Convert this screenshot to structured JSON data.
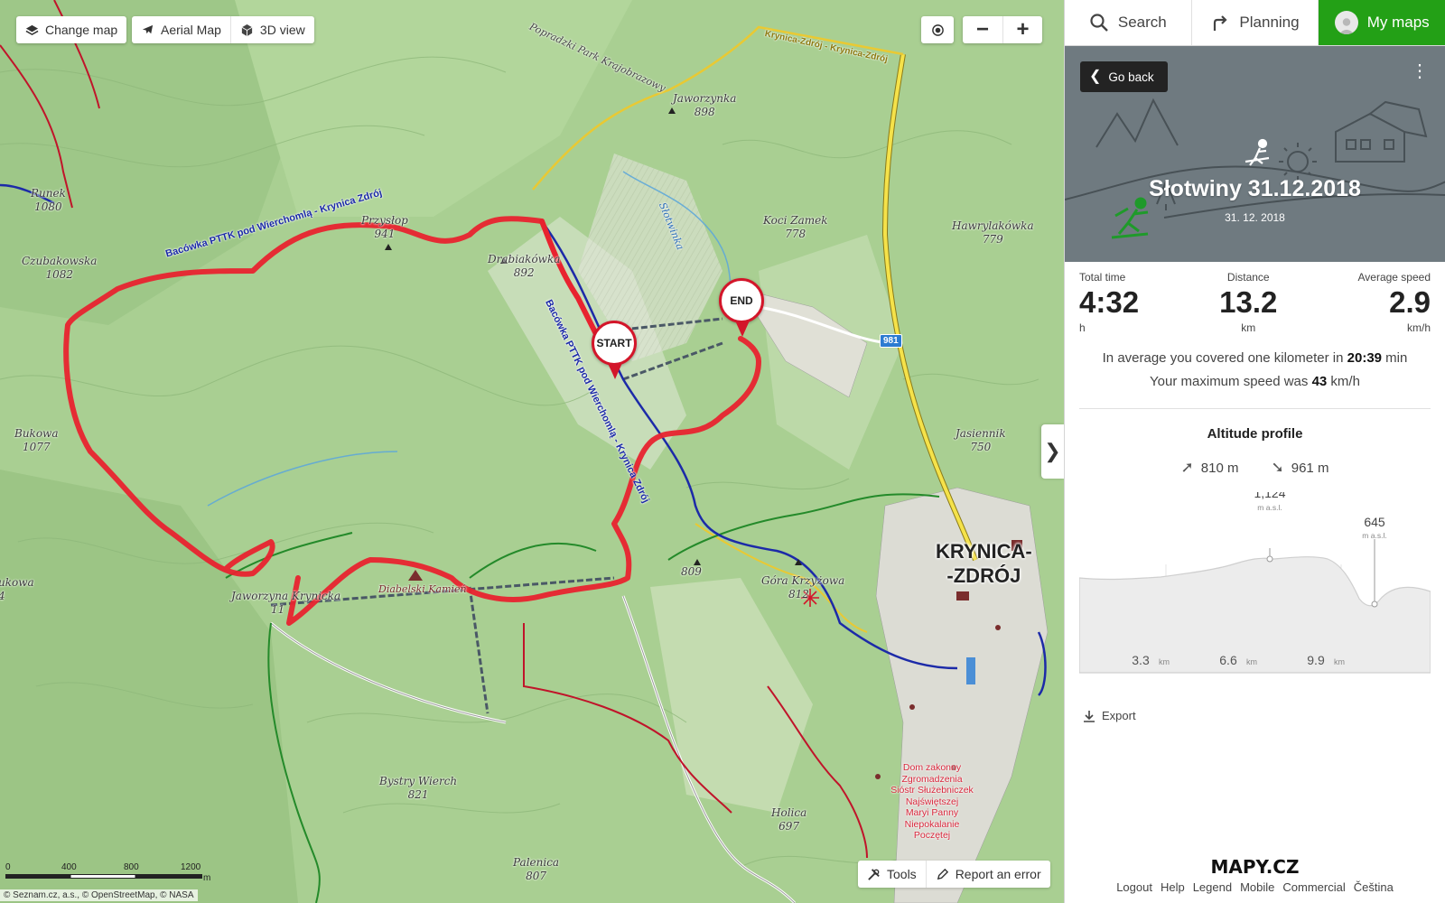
{
  "map_controls": {
    "change_map": "Change map",
    "aerial_map": "Aerial Map",
    "view_3d": "3D view",
    "zoom_out": "−",
    "zoom_in": "+"
  },
  "pins": {
    "start": "START",
    "end": "END"
  },
  "map_labels": {
    "runek": {
      "name": "Runek",
      "num": "1080"
    },
    "czubakowska": {
      "name": "Czubakowska",
      "num": "1082"
    },
    "bukowa": {
      "name": "Bukowa",
      "num": "1077"
    },
    "przyslop": {
      "name": "Przysłop",
      "num": "941"
    },
    "jaworzynka": {
      "name": "Jaworzynka",
      "num": "898"
    },
    "drabiakowka": {
      "name": "Drabiakówka",
      "num": "892"
    },
    "koci_zamek": {
      "name": "Koci Zamek",
      "num": "778"
    },
    "hawrylakowka": {
      "name": "Hawrylakówka",
      "num": "779"
    },
    "jasiennik": {
      "name": "Jasiennik",
      "num": "750"
    },
    "jaworzyna_krynicka": {
      "name": "Jaworzyna Krynicka",
      "num": "11"
    },
    "diabelski_kamien": {
      "name": "Diabelski Kamień"
    },
    "gora_krzyzowa": {
      "name": "Góra Krzyżowa",
      "num": "812"
    },
    "p809": {
      "num": "809"
    },
    "bystry_wierch": {
      "name": "Bystry Wierch",
      "num": "821"
    },
    "holica": {
      "name": "Holica",
      "num": "697"
    },
    "palenica": {
      "name": "Palenica",
      "num": "807"
    },
    "ukowa": {
      "name": "ukowa",
      "num": "4"
    },
    "slotwinka": {
      "name": "Słotwinka"
    },
    "park": {
      "name": "Popradzki Park Krajobrazowy"
    },
    "krynica_road": {
      "name": "Krynica-Zdrój - Krynica-Zdrój"
    }
  },
  "town": {
    "line1": "KRYNICA-",
    "line2": "-ZDRÓJ"
  },
  "poi_red": [
    "Dom zakonny",
    "Zgromadzenia",
    "Sióstr Służebniczek",
    "Najświętszej",
    "Maryi Panny",
    "Niepokalanie",
    "Poczętej"
  ],
  "trails": {
    "upper": "Bacówka PTTK pod Wierchomlą - Krynica Zdrój",
    "middle": "Bacówka PTTK pod Wierchomlą - Krynica Zdrój"
  },
  "route_number": "981",
  "scale": {
    "labels": [
      "0",
      "400",
      "800",
      "1200"
    ],
    "unit": "m"
  },
  "attribution": "© Seznam.cz, a.s., © OpenStreetMap, © NASA",
  "bottom_tools": {
    "tools": "Tools",
    "report": "Report an error"
  },
  "colors": {
    "route": "#e8232f",
    "brand_green": "#23a016",
    "trail_blue": "#1c2aa8"
  },
  "sidebar": {
    "nav": {
      "search": "Search",
      "planning": "Planning",
      "my_maps": "My maps"
    },
    "back": "Go back",
    "menu_icon": "⋮",
    "title": "Słotwiny 31.12.2018",
    "date": "31. 12. 2018",
    "stats": {
      "time_label": "Total time",
      "time_value": "4:32",
      "time_unit": "h",
      "distance_label": "Distance",
      "distance_value": "13.2",
      "distance_unit": "km",
      "speed_label": "Average speed",
      "speed_value": "2.9",
      "speed_unit": "km/h"
    },
    "avg_pre": "In average you covered one kilometer in ",
    "avg_value": "20:39",
    "avg_post": " min",
    "max_pre": "Your maximum speed was ",
    "max_value": "43",
    "max_post": " km/h",
    "altitude": {
      "title": "Altitude profile",
      "ascent": "810 m",
      "descent": "961 m",
      "max_value": "1,124",
      "max_unit": "m a.s.l.",
      "min_value": "645",
      "min_unit": "m a.s.l.",
      "x_ticks": [
        {
          "value": "3.3",
          "unit": "km"
        },
        {
          "value": "6.6",
          "unit": "km"
        },
        {
          "value": "9.9",
          "unit": "km"
        }
      ]
    },
    "export": "Export",
    "logo": "MAPY.CZ",
    "footer": [
      "Logout",
      "Help",
      "Legend",
      "Mobile",
      "Commercial",
      "Čeština"
    ]
  }
}
